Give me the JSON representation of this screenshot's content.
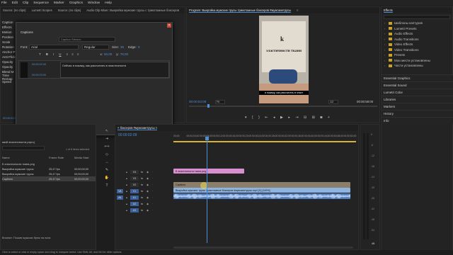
{
  "menu": [
    "File",
    "Edit",
    "Clip",
    "Sequence",
    "Marker",
    "Graphics",
    "Window",
    "Help"
  ],
  "source_panel": {
    "tabs": [
      "Source: (no clips)",
      "Lumetri Scopes",
      "Source: (no clips)",
      "Audio Clip Mixer: Выкройка мужские трусы с трикотажные боксеров"
    ],
    "left_items": [
      "Caption",
      "Effects",
      "Motion",
      "Position",
      "Scale",
      "Rotation",
      "Anchor P",
      "Anti-Flick",
      "Opacity",
      "Opacity",
      "Blend M",
      "Time Remap",
      "Speed"
    ],
    "timestamp": "00:00:02:09"
  },
  "caption_dialog": {
    "title": "Captions",
    "search_placeholder": "Caption Stream:",
    "font_label": "Font:",
    "font_value": "Arial",
    "style_value": "Regular",
    "size_label": "Size:",
    "size_value": "35",
    "edge_label": "Edge:",
    "edge_value": "0",
    "x_label": "x:",
    "x_value": "50,00",
    "y_label": "y:",
    "y_value": "78,00",
    "caption": {
      "in_time": "00:00:02:00",
      "out_time": "00:00:03:00",
      "text": "Сейчас я покажу, как рассчитать в эластичности"
    },
    "add_button": "+",
    "remove_button": "−"
  },
  "program_monitor": {
    "title": "Program: Выкройка мужские трусы трикотажные боксеров #мужскиетрусы",
    "menu_icon": "≡",
    "video_heading": "эластичности ткани",
    "logo_letter": "k",
    "subtitle": "я покажу, как рассчитать в эласт",
    "current_time": "00:00:02:09",
    "fit": "Fit",
    "quality": "1/2",
    "duration": "00:00:58:00"
  },
  "effects_panel": {
    "title": "Effects",
    "items": [
      "Шаблоны каптуров",
      "Lumetri Presets",
      "Audio Effects",
      "Audio Transitions",
      "Video Effects",
      "Video Transitions",
      "Presets",
      "Мои мести установлены",
      "Части установлены"
    ],
    "sections": [
      "Essential Graphics",
      "Essential Sound",
      "Lumetri Color",
      "Libraries",
      "Markers",
      "History",
      "Info"
    ]
  },
  "project_panel": {
    "tabs": [
      "Project: Выкройка мужские трусы",
      "Media Browser"
    ],
    "path": "ккий эластичности.prproj",
    "selection": "1 of 6 items selected",
    "columns": [
      "Name",
      "Frame Rate",
      "Media Start"
    ],
    "rows": [
      {
        "name": "Б эластичности ткани.png",
        "rate": "",
        "start": ""
      },
      {
        "name": "Выкройка мужские трусы",
        "rate": "25,47 fps",
        "start": "00;00;00;00"
      },
      {
        "name": "Выкройка мужские трусы",
        "rate": "25,47 fps",
        "start": "00;00;00;00"
      },
      {
        "name": "Captions",
        "rate": "25,47 fps",
        "start": "00;00;00;00"
      }
    ],
    "footer": "Browser: Пошив мужских брюк на льна"
  },
  "timeline": {
    "tabs": [
      "× боксеров #мужскиетрусы ≡"
    ],
    "timecode": "00:00:02:09",
    "ruler_labels": [
      "00;00",
      "00;00;04;00",
      "00;00;08;00",
      "00;00;12;00",
      "00;00;16;00",
      "00;00;20;00",
      "00;00;24;00",
      "00;00;28;00",
      "00;00;32;00",
      "00;00;36;00",
      "00;00;40;00",
      "00;00;44;00",
      "00;00;48;00",
      "00;00;52;00"
    ],
    "tracks": [
      "V4",
      "V3",
      "V2",
      "V1",
      "A1",
      "A2",
      "A3"
    ],
    "src_target": "V1",
    "src_audio": "A1",
    "clip_image": "Б эластичности ткани.png",
    "clip_caption": "Captions",
    "clip_caption_text": "Сейчас я покажу...",
    "clip_video": "Выкройка мужские трусы трикотажные боксеров #мужскиетрусы.mp4 [V] [149%]",
    "audio_meter_labels": [
      "0",
      "-6",
      "-12",
      "-18",
      "-24",
      "-30",
      "-36",
      "-42",
      "-48",
      "-54"
    ],
    "db_label": "dB"
  },
  "status_bar": "Click to select or click in empty space and drag to marquee select. Use Shift, Alt, and Ctrl for other options.",
  "colors": {
    "image_clip": "#d88fd0",
    "caption_clip": "#8b7f6a",
    "video_clip": "#8fb3df",
    "audio_clip": "#4f7bbd",
    "playhead": "#4d8fd6"
  }
}
